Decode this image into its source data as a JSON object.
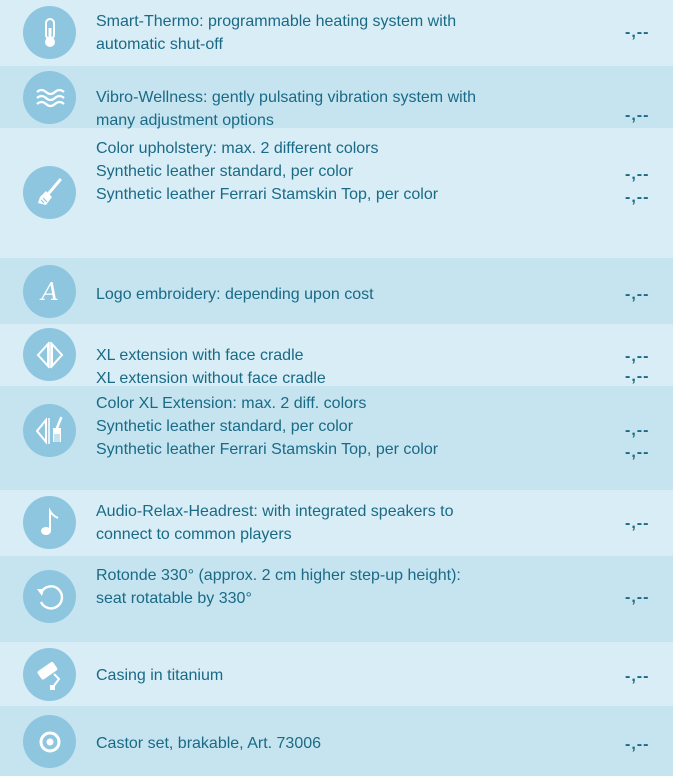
{
  "colors": {
    "background": "#d8edf5",
    "band": "#c5e4ef",
    "icon_circle": "#8ec6e0",
    "text": "#1a6a86"
  },
  "items": [
    {
      "icon": "thermometer-icon",
      "lines": [
        "Smart-Thermo: programmable heating system with",
        "automatic shut-off"
      ],
      "prices": [
        "-,--"
      ]
    },
    {
      "icon": "waves-icon",
      "lines": [
        "Vibro-Wellness: gently pulsating vibration system with",
        "many adjustment options"
      ],
      "prices": [
        "-,--"
      ]
    },
    {
      "icon": "paintbrush-icon",
      "lines": [
        "Color upholstery: max. 2 different colors",
        "Synthetic leather standard, per color",
        "Synthetic leather Ferrari Stamskin Top, per color"
      ],
      "prices": [
        "-,--",
        "-,--"
      ]
    },
    {
      "icon": "script-a-logo-icon",
      "lines": [
        "Logo embroidery: depending upon cost"
      ],
      "prices": [
        "-,--"
      ]
    },
    {
      "icon": "extension-arrows-icon",
      "lines": [
        "XL extension with face cradle",
        "XL extension without face cradle"
      ],
      "prices": [
        "-,--",
        "-,--"
      ]
    },
    {
      "icon": "extension-brush-icon",
      "lines": [
        "Color XL Extension: max. 2 diff. colors",
        "Synthetic leather standard, per color",
        "Synthetic leather Ferrari Stamskin Top, per color"
      ],
      "prices": [
        "-,--",
        "-,--"
      ]
    },
    {
      "icon": "music-note-icon",
      "lines": [
        "Audio-Relax-Headrest: with integrated speakers to",
        "connect to common players"
      ],
      "prices": [
        "-,--"
      ]
    },
    {
      "icon": "rotate-icon",
      "lines": [
        "Rotonde 330° (approx. 2 cm higher step-up height):",
        "seat rotatable by 330°"
      ],
      "prices": [
        "-,--"
      ]
    },
    {
      "icon": "paint-roller-icon",
      "lines": [
        "Casing in titanium"
      ],
      "prices": [
        "-,--"
      ]
    },
    {
      "icon": "castor-wheel-icon",
      "lines": [
        "Castor set, brakable, Art. 73006"
      ],
      "prices": [
        "-,--"
      ]
    }
  ]
}
